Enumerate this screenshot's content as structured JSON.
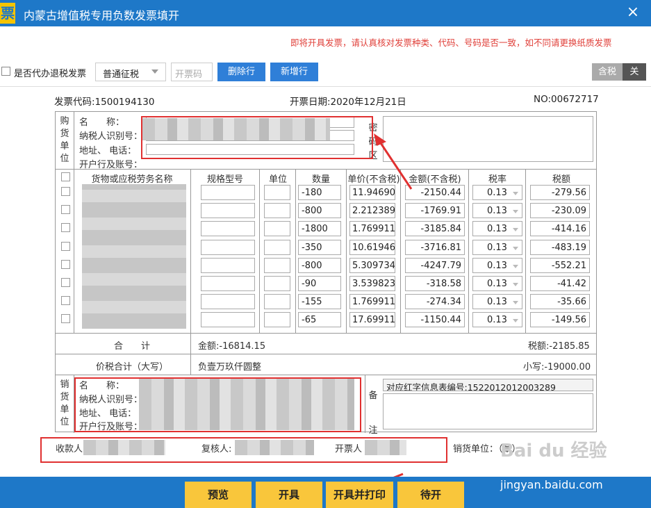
{
  "window": {
    "title": "内蒙古增值税专用负数发票填开",
    "logo_char": "票",
    "close": "×"
  },
  "notice": "即将开具发票，请认真核对发票种类、代码、号码是否一致，如不同请更换纸质发票",
  "toolbar": {
    "agent_refund_label": "是否代办退税发票",
    "levy_type": "普通征税",
    "code_placeholder": "开票码",
    "delete_row": "删除行",
    "add_row": "新增行",
    "tax_included": "含税",
    "close": "关"
  },
  "invoice": {
    "code": "发票代码:1500194130",
    "date": "开票日期:2020年12月21日",
    "number": "NO:00672717"
  },
  "buyer": {
    "section": [
      "购",
      "货",
      "单",
      "位"
    ],
    "name_label": "名　　称：",
    "tax_id_label": "纳税人识别号：",
    "addr_label": "地址、 电话：",
    "bank_label": "开户行及账号："
  },
  "cipher": {
    "label": [
      "密",
      "码",
      "区"
    ]
  },
  "columns": [
    "货物或应税劳务名称",
    "规格型号",
    "单位",
    "数量",
    "单价(不含税)",
    "金额(不含税)",
    "税率",
    "税额"
  ],
  "rows": [
    {
      "qty": "-180",
      "price": "11.94690",
      "amount": "-2150.44",
      "rate": "0.13",
      "tax": "-279.56"
    },
    {
      "qty": "-800",
      "price": "2.212389",
      "amount": "-1769.91",
      "rate": "0.13",
      "tax": "-230.09"
    },
    {
      "qty": "-1800",
      "price": "1.769911",
      "amount": "-3185.84",
      "rate": "0.13",
      "tax": "-414.16"
    },
    {
      "qty": "-350",
      "price": "10.61946",
      "amount": "-3716.81",
      "rate": "0.13",
      "tax": "-483.19"
    },
    {
      "qty": "-800",
      "price": "5.309734",
      "amount": "-4247.79",
      "rate": "0.13",
      "tax": "-552.21"
    },
    {
      "qty": "-90",
      "price": "3.539823",
      "amount": "-318.58",
      "rate": "0.13",
      "tax": "-41.42"
    },
    {
      "qty": "-155",
      "price": "1.769911",
      "amount": "-274.34",
      "rate": "0.13",
      "tax": "-35.66"
    },
    {
      "qty": "-65",
      "price": "17.69911",
      "amount": "-1150.44",
      "rate": "0.13",
      "tax": "-149.56"
    }
  ],
  "totals": {
    "label": "合　　计",
    "amount": "金额:-16814.15",
    "tax": "税额:-2185.85",
    "grand_label": "价税合计（大写）",
    "grand_words": "负壹万玖仟圆整",
    "grand_small": "小写:-19000.00"
  },
  "seller": {
    "section": [
      "销",
      "货",
      "单",
      "位"
    ],
    "name_label": "名　　称：",
    "tax_id_label": "纳税人识别号：",
    "addr_label": "地址、 电话：",
    "bank_label": "开户行及账号："
  },
  "remarks": {
    "label": [
      "备",
      "注"
    ],
    "red_info": "对应红字信息表编号:1522012012003289"
  },
  "signers": {
    "payee": "收款人",
    "reviewer": "复核人:",
    "issuer": "开票人",
    "seller_stamp": "销货单位：（章）"
  },
  "actions": {
    "preview": "预览",
    "issue": "开具",
    "issue_print": "开具并打印",
    "pending": "待开"
  },
  "watermark": {
    "brand": "Bai du 经验",
    "url": "jingyan.baidu.com"
  }
}
